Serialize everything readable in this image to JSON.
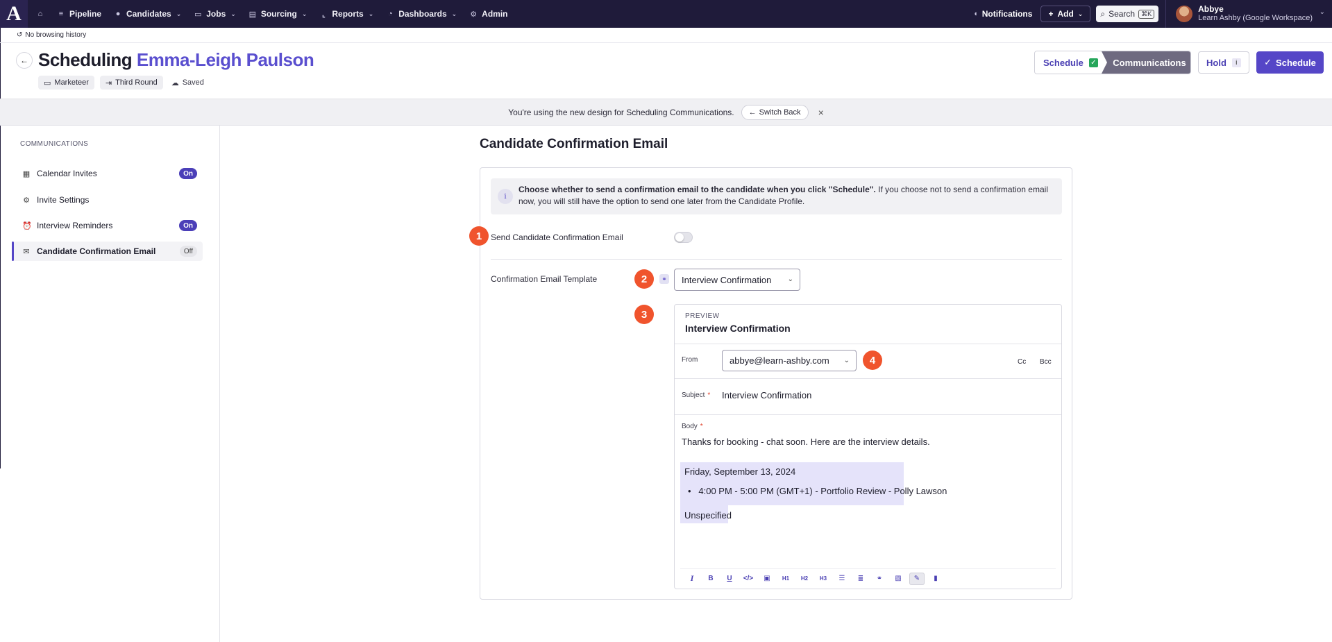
{
  "nav": {
    "logo": "A",
    "items": [
      {
        "label": "Pipeline"
      },
      {
        "label": "Candidates"
      },
      {
        "label": "Jobs"
      },
      {
        "label": "Sourcing"
      },
      {
        "label": "Reports"
      },
      {
        "label": "Dashboards"
      },
      {
        "label": "Admin"
      }
    ],
    "notifications": "Notifications",
    "add": "Add",
    "search": "Search",
    "search_shortcut": "⌘K",
    "user_name": "Abbye",
    "user_org": "Learn Ashby (Google Workspace)"
  },
  "history": {
    "label": "No browsing history"
  },
  "header": {
    "title_prefix": "Scheduling",
    "candidate": "Emma-Leigh Paulson",
    "chips": [
      "Marketeer",
      "Third Round"
    ],
    "saved": "Saved",
    "step_schedule": "Schedule",
    "step_communications": "Communications",
    "hold": "Hold",
    "hold_info": "i",
    "schedule_button": "Schedule"
  },
  "banner": {
    "text": "You're using the new design for Scheduling Communications.",
    "switch_back": "Switch Back"
  },
  "sidebar": {
    "section": "COMMUNICATIONS",
    "items": [
      {
        "label": "Calendar Invites",
        "badge": "On"
      },
      {
        "label": "Invite Settings",
        "badge": ""
      },
      {
        "label": "Interview Reminders",
        "badge": "On"
      },
      {
        "label": "Candidate Confirmation Email",
        "badge": "Off"
      }
    ]
  },
  "main": {
    "title": "Candidate Confirmation Email",
    "info_bold": "Choose whether to send a confirmation email to the candidate when you click \"Schedule\".",
    "info_rest": " If you choose not to send a confirmation email now, you will still have the option to send one later from the Candidate Profile.",
    "send_toggle_label": "Send Candidate Confirmation Email",
    "send_toggle_on": false,
    "template_label": "Confirmation Email Template",
    "template_value": "Interview Confirmation",
    "markers": [
      "1",
      "2",
      "3",
      "4"
    ],
    "preview": {
      "label": "PREVIEW",
      "title": "Interview Confirmation",
      "from_label": "From",
      "from_value": "abbye@learn-ashby.com",
      "cc": "Cc",
      "bcc": "Bcc",
      "subject_label": "Subject",
      "subject_value": "Interview Confirmation",
      "body_label": "Body",
      "body_text": "Thanks for booking - chat soon. Here are the interview details.",
      "date": "Friday, September 13, 2024",
      "slot": "4:00 PM - 5:00 PM (GMT+1) - Portfolio Review - Polly Lawson",
      "location": "Unspecified",
      "req_marker": "*"
    }
  },
  "colors": {
    "accent": "#5546c7",
    "nav_bg": "#1f1b3a",
    "marker": "#f0542d"
  }
}
